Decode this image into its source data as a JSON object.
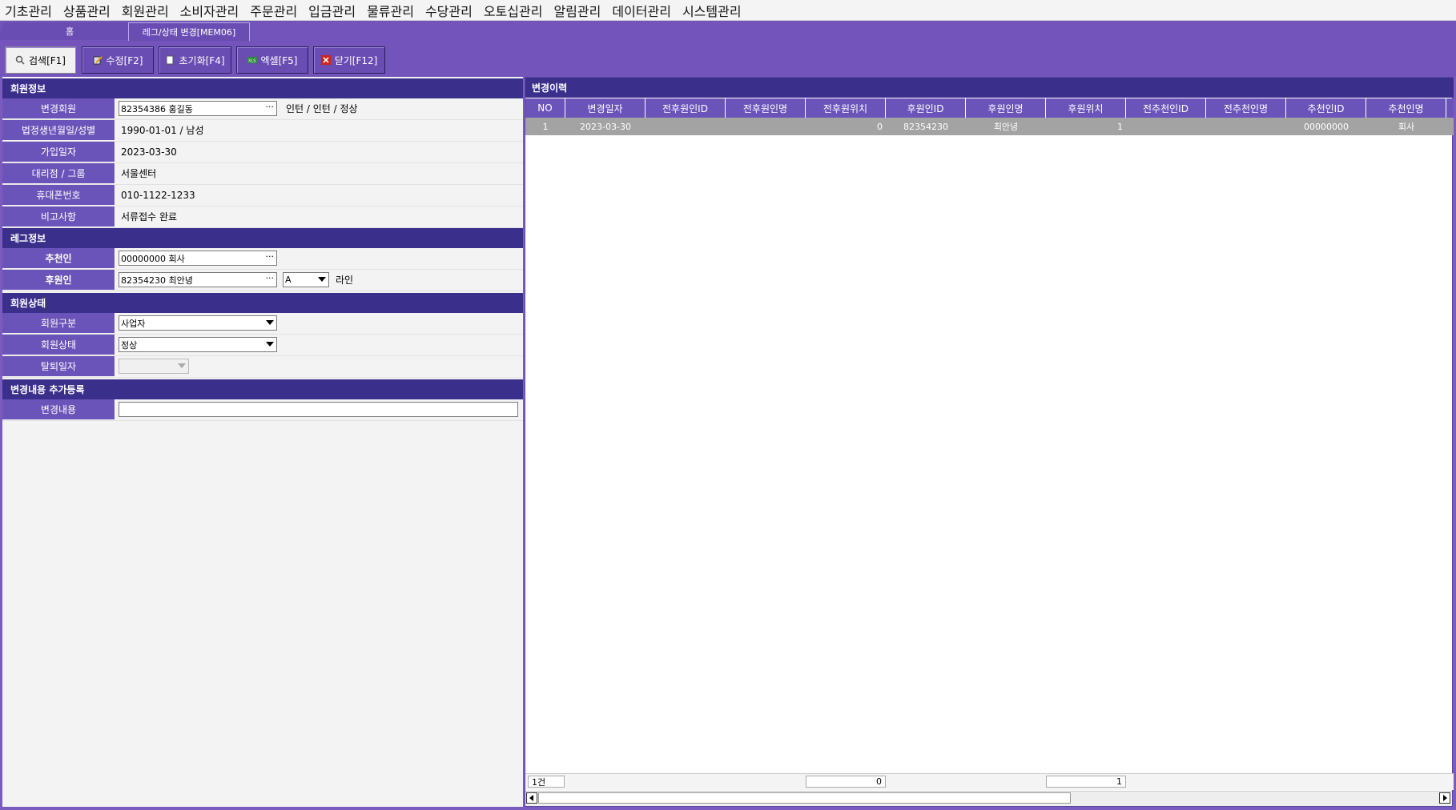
{
  "menu": [
    "기초관리",
    "상품관리",
    "회원관리",
    "소비자관리",
    "주문관리",
    "입금관리",
    "물류관리",
    "수당관리",
    "오토십관리",
    "알림관리",
    "데이터관리",
    "시스템관리"
  ],
  "tabs": {
    "home": "홈",
    "active": "레그/상태 변경[MEM06]"
  },
  "toolbar": {
    "search": "검색[F1]",
    "edit": "수정[F2]",
    "reset": "초기화[F4]",
    "excel": "엑셀[F5]",
    "close": "닫기[F12]"
  },
  "member_info": {
    "title": "회원정보",
    "change_member_label": "변경회원",
    "change_member_value": "82354386 홍길동",
    "change_member_status": "인턴 / 인턴 / 정상",
    "birth_label": "법정생년월일/성별",
    "birth_value": "1990-01-01 / 남성",
    "join_label": "가입일자",
    "join_value": "2023-03-30",
    "agency_label": "대리점 / 그룹",
    "agency_value": "서울센터",
    "phone_label": "휴대폰번호",
    "phone_value": "010-1122-1233",
    "note_label": "비고사항",
    "note_value": "서류접수 완료"
  },
  "leg_info": {
    "title": "레그정보",
    "recommender_label": "추천인",
    "recommender_value": "00000000 회사",
    "sponsor_label": "후원인",
    "sponsor_value": "82354230 최안녕",
    "line_value": "A",
    "line_label": "라인"
  },
  "member_status": {
    "title": "회원상태",
    "type_label": "회원구분",
    "type_value": "사업자",
    "status_label": "회원상태",
    "status_value": "정상",
    "withdraw_label": "탈퇴일자",
    "withdraw_value": ""
  },
  "change_add": {
    "title": "변경내용 추가등록",
    "content_label": "변경내용",
    "content_value": ""
  },
  "history": {
    "title": "변경이력",
    "columns": [
      "NO",
      "변경일자",
      "전후원인ID",
      "전후원인명",
      "전후원위치",
      "후원인ID",
      "후원인명",
      "후원위치",
      "전추천인ID",
      "전추천인명",
      "추천인ID",
      "추천인명"
    ],
    "rows": [
      [
        "1",
        "2023-03-30",
        "",
        "",
        "0",
        "82354230",
        "최안녕",
        "1",
        "",
        "",
        "00000000",
        "회사"
      ]
    ],
    "footer": {
      "count": "1건",
      "sum_prev_pos": "0",
      "sum_pos": "1"
    }
  },
  "colors": {
    "header": "#3b2f8c",
    "label": "#6b54b9",
    "bar": "#7354bb"
  }
}
